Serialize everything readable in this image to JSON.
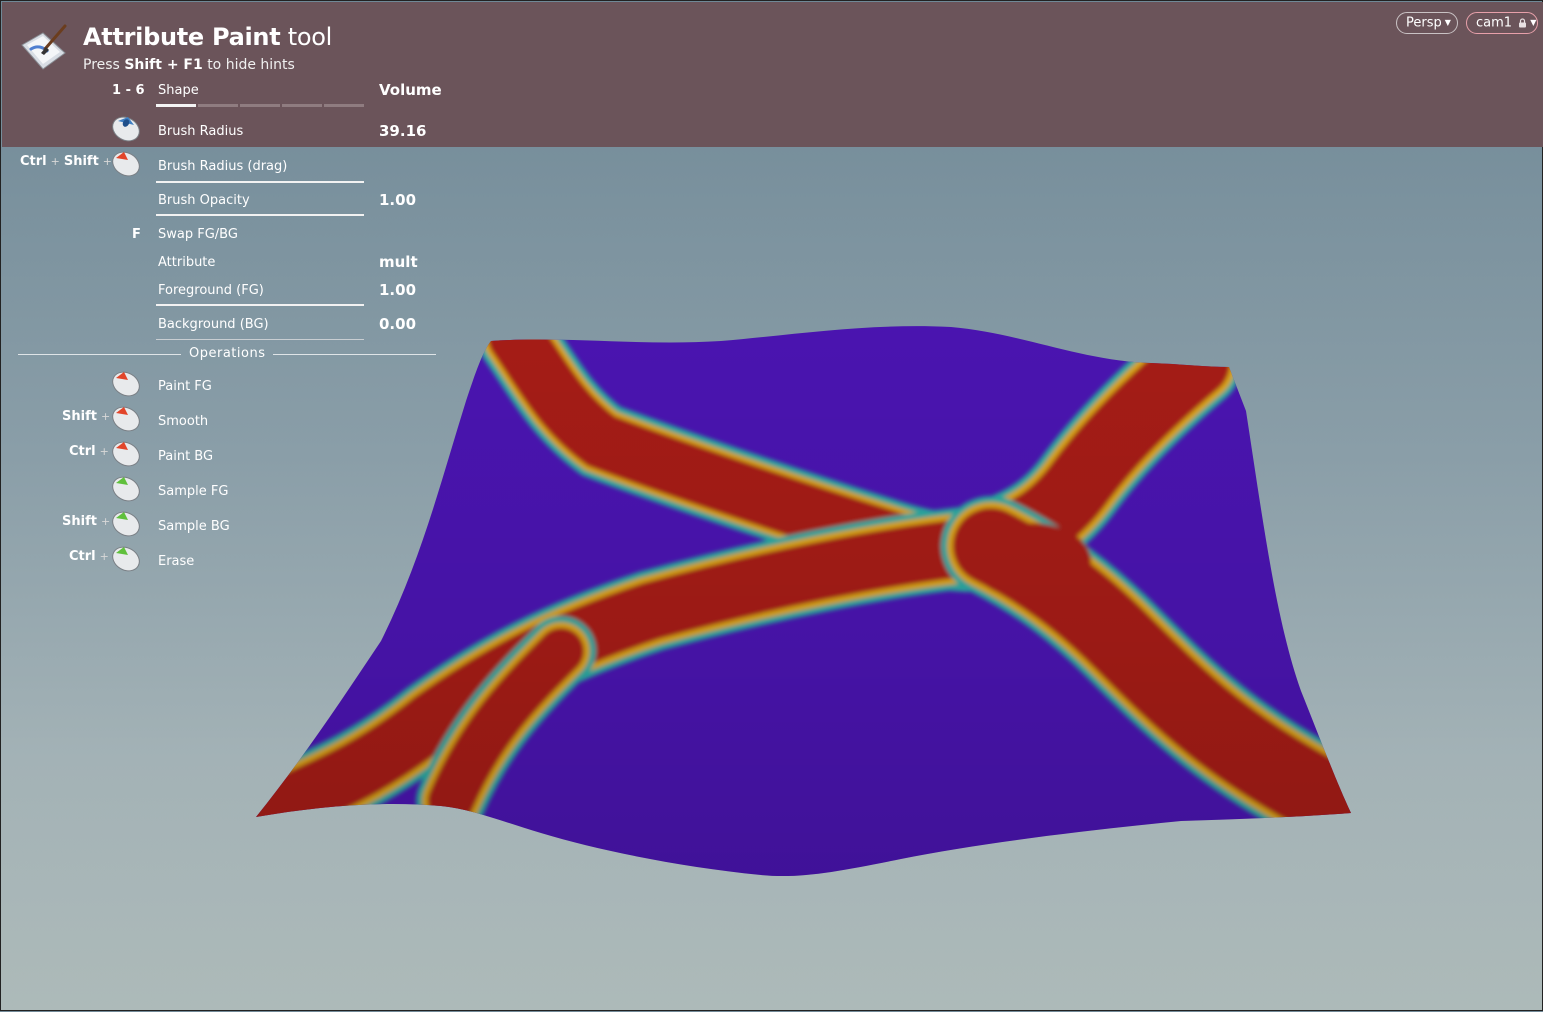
{
  "view": {
    "persp_label": "Persp",
    "camera_label": "cam1",
    "lock_icon": "lock-icon",
    "dropdown_icon": "caret-down-icon"
  },
  "tool": {
    "icon": "paint-brush-tool-icon",
    "title_bold": "Attribute Paint",
    "title_light": "tool",
    "hint_prefix": "Press",
    "hint_keys": "Shift + F1",
    "hint_suffix": "to hide hints"
  },
  "params": {
    "shape": {
      "key": "1 - 6",
      "label": "Shape",
      "value": "Volume",
      "segments": 5,
      "active_segment": 1
    },
    "brush_radius": {
      "label": "Brush Radius",
      "value": "39.16"
    },
    "brush_radius_drag": {
      "key_mod1": "Ctrl",
      "key_plus": "+",
      "key_mod2": "Shift",
      "label": "Brush Radius (drag)"
    },
    "brush_opacity": {
      "label": "Brush Opacity",
      "value": "1.00"
    },
    "swap": {
      "key": "F",
      "label": "Swap FG/BG"
    },
    "attribute": {
      "label": "Attribute",
      "value": "mult"
    },
    "foreground": {
      "label": "Foreground (FG)",
      "value": "1.00"
    },
    "background": {
      "label": "Background (BG)",
      "value": "0.00"
    }
  },
  "operations": {
    "title": "Operations",
    "items": [
      {
        "key": "",
        "label": "Paint FG",
        "button": "left"
      },
      {
        "key": "Shift",
        "label": "Smooth",
        "button": "left"
      },
      {
        "key": "Ctrl",
        "label": "Paint BG",
        "button": "left"
      },
      {
        "key": "",
        "label": "Sample FG",
        "button": "middle"
      },
      {
        "key": "Shift",
        "label": "Sample BG",
        "button": "middle"
      },
      {
        "key": "Ctrl",
        "label": "Erase",
        "button": "middle"
      }
    ]
  },
  "colors": {
    "hud_band": "#6b545a",
    "mask_background": "#4a14b0",
    "mask_foreground": "#a51c14",
    "left_button": "#e2452a",
    "middle_button": "#5fc03c",
    "wheel": "#3f7fc2"
  }
}
